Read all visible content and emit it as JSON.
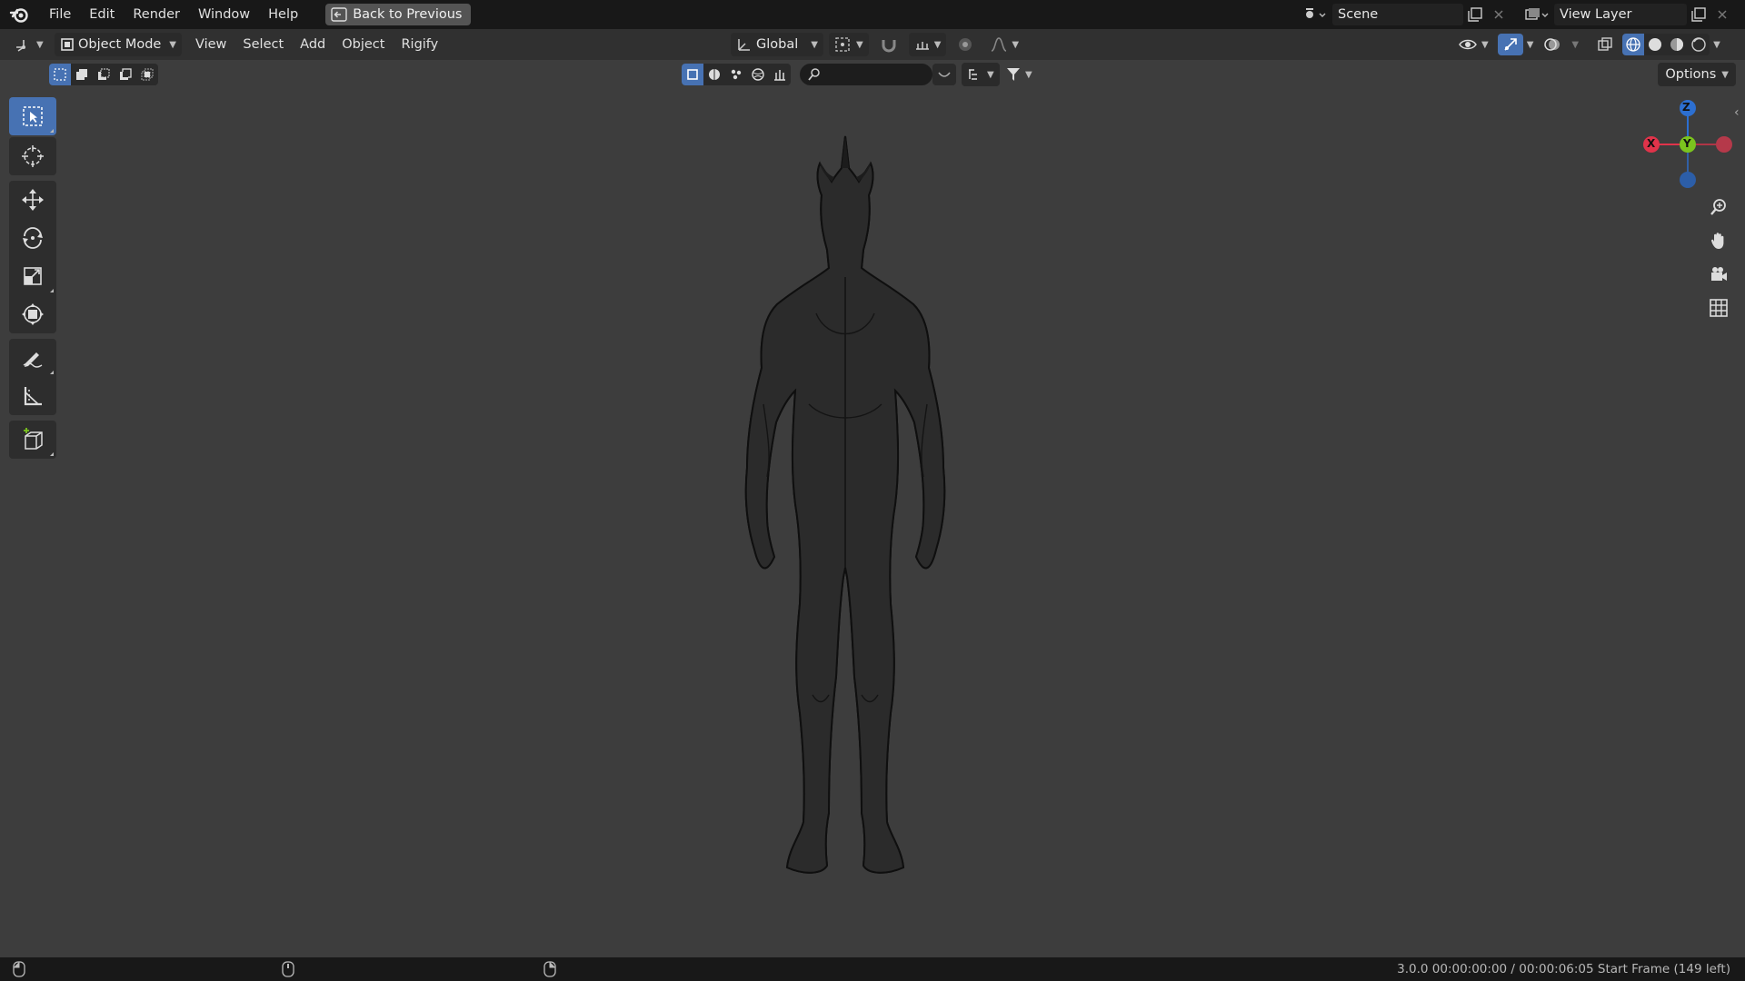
{
  "topbar": {
    "menus": [
      "File",
      "Edit",
      "Render",
      "Window",
      "Help"
    ],
    "back_button": "Back to Previous",
    "scene_name": "Scene",
    "view_layer_name": "View Layer"
  },
  "header": {
    "mode": "Object Mode",
    "menus": [
      "View",
      "Select",
      "Add",
      "Object",
      "Rigify"
    ],
    "transform_orientation": "Global"
  },
  "subheader": {
    "search_placeholder": "",
    "options_label": "Options"
  },
  "gizmo": {
    "z": "Z",
    "y": "Y",
    "x": "X",
    "colors": {
      "x": "#e0334a",
      "y": "#7bc41e",
      "z": "#2c6fd1"
    }
  },
  "toolbar": {
    "tools": [
      "select-box",
      "cursor",
      "move",
      "rotate",
      "scale",
      "transform",
      "annotate",
      "measure",
      "add-cube"
    ],
    "active": "select-box"
  },
  "statusbar": {
    "text": "3.0.0  00:00:00:00 / 00:00:06:05  Start Frame (149 left)"
  },
  "theme": {
    "accent": "#4772b3",
    "viewport_bg": "#3d3d3d",
    "wire": "#1a1a1a"
  }
}
